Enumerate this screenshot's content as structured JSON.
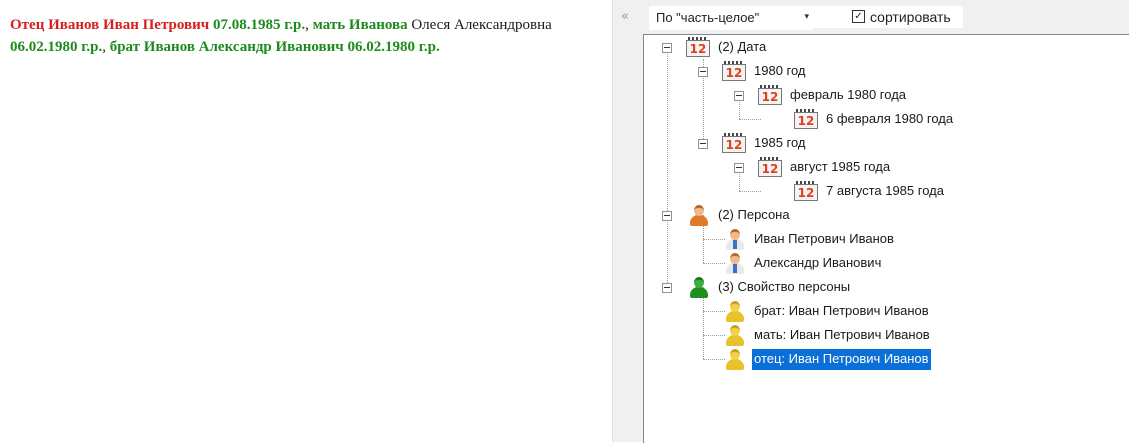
{
  "document": {
    "parts": [
      {
        "text": "Отец Иванов Иван Петрович",
        "style": "red"
      },
      {
        "text": " 07.08.1985 г.р.",
        "style": "green"
      },
      {
        "text": ", ",
        "style": "plain"
      },
      {
        "text": "мать Иванова",
        "style": "green"
      },
      {
        "text": " Олеся Александровна",
        "style": "plain"
      },
      {
        "text": " 06.02.1980 г.р.",
        "style": "green"
      },
      {
        "text": ", ",
        "style": "plain"
      },
      {
        "text": "брат Иванов Александр Иванович 06.02.1980 г.р.",
        "style": "green"
      }
    ]
  },
  "splitter": {
    "arrow": "«"
  },
  "toolbar": {
    "grouping_value": "По \"часть-целое\"",
    "grouping_arrow": "▾",
    "sort_checked_mark": "✓",
    "sort_label": "сортировать"
  },
  "tree": {
    "nodes": [
      {
        "label": "(2) Дата",
        "icon": "calendar-icon",
        "depth": 0,
        "expanded": true
      },
      {
        "label": "1980 год",
        "icon": "calendar-icon",
        "depth": 1,
        "expanded": true
      },
      {
        "label": "февраль 1980 года",
        "icon": "calendar-icon",
        "depth": 2,
        "expanded": true
      },
      {
        "label": "6 февраля 1980 года",
        "icon": "calendar-icon",
        "depth": 3
      },
      {
        "label": "1985 год",
        "icon": "calendar-icon",
        "depth": 1,
        "expanded": true
      },
      {
        "label": "август 1985 года",
        "icon": "calendar-icon",
        "depth": 2,
        "expanded": true
      },
      {
        "label": "7 августа 1985 года",
        "icon": "calendar-icon",
        "depth": 3
      },
      {
        "label": "(2) Персона",
        "icon": "person-group-icon",
        "depth": 0,
        "expanded": true
      },
      {
        "label": "Иван Петрович Иванов",
        "icon": "person-icon",
        "depth": 1
      },
      {
        "label": "Александр Иванович",
        "icon": "person-icon",
        "depth": 1
      },
      {
        "label": "(3) Свойство персоны",
        "icon": "person-property-group-icon",
        "depth": 0,
        "expanded": true
      },
      {
        "label": "брат: Иван Петрович Иванов",
        "icon": "person-property-icon",
        "depth": 1
      },
      {
        "label": "мать: Иван Петрович Иванов",
        "icon": "person-property-icon",
        "depth": 1
      },
      {
        "label": "отец: Иван Петрович Иванов",
        "icon": "person-property-icon",
        "depth": 1,
        "selected": true
      }
    ],
    "calendar_number": "12"
  },
  "colors": {
    "highlight_red": "#d42020",
    "highlight_green": "#1d8a1d",
    "selection": "#0a6fd6"
  }
}
